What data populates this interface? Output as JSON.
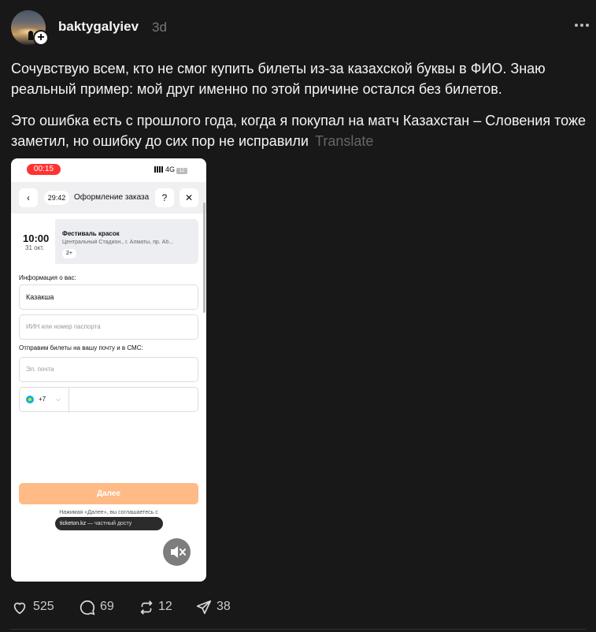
{
  "post": {
    "username": "baktygalyiev",
    "age": "3d",
    "paragraph1": "Сочувствую всем, кто не смог купить билеты из-за казахской буквы в ФИО. Знаю реальный пример: мой друг именно по этой причине остался без билетов.",
    "paragraph2": "Это ошибка есть с прошлого года, когда я покупал на матч Казахстан – Словения тоже заметил, но ошибку до сих пор не исправили",
    "translate_label": "Translate"
  },
  "screenshot": {
    "status_time": "00:15",
    "network": "4G",
    "battery": "12",
    "timer": "29:42",
    "order_title": "Оформление заказа",
    "help_label": "?",
    "close_label": "✕",
    "back_label": "‹",
    "event_time": "10:00",
    "event_date": "31 окт.",
    "event_name": "Фестиваль красок",
    "event_address": "Центральный Стадион., г. Алматы, пр. Аб...",
    "event_count": "2+",
    "info_label": "Информация о вас:",
    "name_value": "Казакша",
    "iin_placeholder": "ИИН или номер паспорта",
    "send_label": "Отправим билеты на вашу почту и в СМС:",
    "email_placeholder": "Эл. почта",
    "phone_code": "+7",
    "next_button": "Далее",
    "agree_text": "Нажимая «Далее», вы соглашаетесь с",
    "toast_domain": "ticketon.kz",
    "toast_text": " — частный досту"
  },
  "actions": {
    "likes": "525",
    "comments": "69",
    "reposts": "12",
    "shares": "38"
  },
  "icons": [
    "plus-icon",
    "more-icon",
    "back-icon",
    "help-icon",
    "close-icon",
    "mute-icon",
    "heart-icon",
    "comment-icon",
    "repost-icon",
    "share-icon"
  ]
}
